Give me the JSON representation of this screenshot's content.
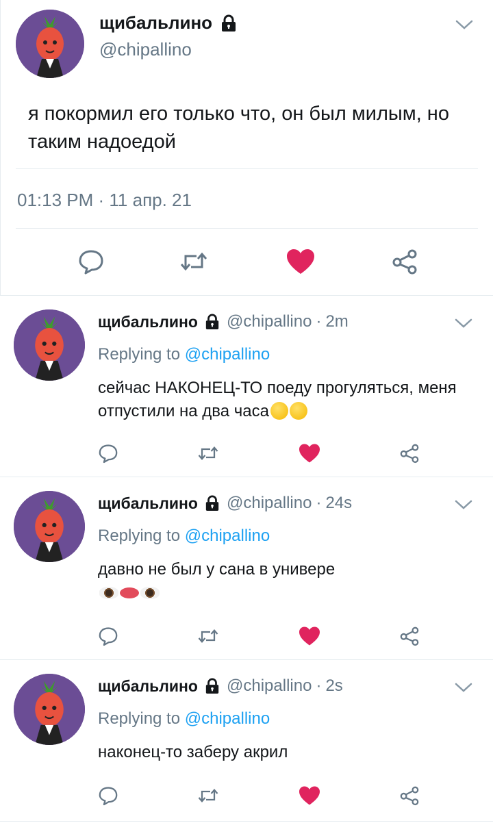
{
  "user": {
    "name": "щибальлино",
    "handle": "@chipallino",
    "avatar": "avatar-icon",
    "lock": "lock-icon"
  },
  "main_tweet": {
    "text": "я покормил его только что, он был милым, но таким надоедой",
    "timestamp": "01:13 PM · 11 апр. 21",
    "actions": [
      "reply-icon",
      "retweet-icon",
      "like-icon",
      "share-icon"
    ],
    "like_color": "#e0245e"
  },
  "replies": [
    {
      "name": "щибальлино",
      "handle": "@chipallino",
      "sep": "·",
      "time": "2m",
      "replying_label": "Replying to",
      "replying_to": "@chipallino",
      "text": "сейчас НАКОНЕЦ-ТО поеду прогуляться, меня отпустили на два часа",
      "emojis": [
        "drooling-face-emoji",
        "frowning-face-emoji"
      ]
    },
    {
      "name": "щибальлино",
      "handle": "@chipallino",
      "sep": "·",
      "time": "24s",
      "replying_label": "Replying to",
      "replying_to": "@chipallino",
      "text": "давно не был у сана в универе",
      "emojis": [
        "eye-emoji",
        "lips-emoji",
        "eye-emoji"
      ]
    },
    {
      "name": "щибальлино",
      "handle": "@chipallino",
      "sep": "·",
      "time": "2s",
      "replying_label": "Replying to",
      "replying_to": "@chipallino",
      "text": "наконец-то заберу акрил",
      "emojis": []
    }
  ],
  "colors": {
    "text": "#14171a",
    "secondary": "#657786",
    "mention": "#1da1f2",
    "like": "#e0245e",
    "divider": "#e6ecf0"
  }
}
